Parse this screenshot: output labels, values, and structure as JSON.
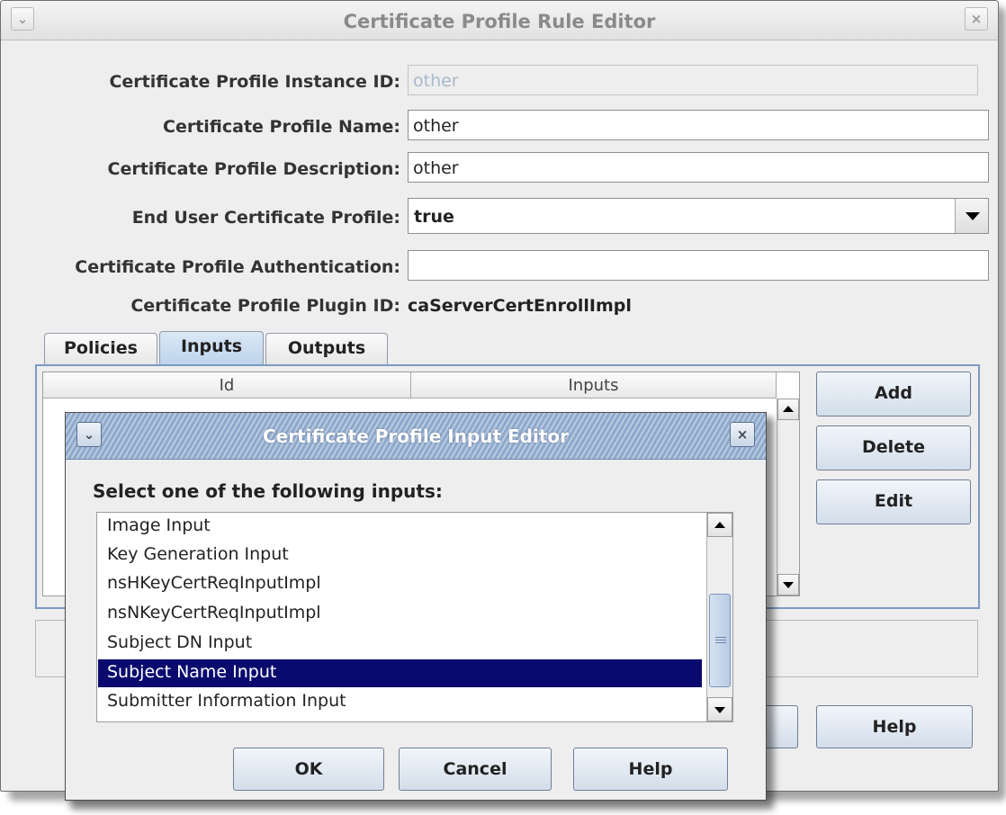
{
  "main_window": {
    "title": "Certificate Profile Rule Editor",
    "menu_icon": "chevron-down-icon",
    "close_icon": "close-icon"
  },
  "form": {
    "instance_id_label": "Certificate Profile Instance ID:",
    "instance_id_value": "other",
    "name_label": "Certificate Profile Name:",
    "name_value": "other",
    "description_label": "Certificate Profile Description:",
    "description_value": "other",
    "end_user_label": "End User Certificate Profile:",
    "end_user_value": "true",
    "authentication_label": "Certificate Profile Authentication:",
    "authentication_value": "",
    "plugin_id_label": "Certificate Profile Plugin ID:",
    "plugin_id_value": "caServerCertEnrollImpl"
  },
  "tabs": [
    {
      "label": "Policies",
      "active": false
    },
    {
      "label": "Inputs",
      "active": true
    },
    {
      "label": "Outputs",
      "active": false
    }
  ],
  "inputs_table": {
    "columns": [
      "Id",
      "Inputs"
    ],
    "rows": []
  },
  "side_buttons": {
    "add": "Add",
    "delete": "Delete",
    "edit": "Edit"
  },
  "bottom_buttons": {
    "help": "Help"
  },
  "dialog": {
    "title": "Certificate Profile Input Editor",
    "prompt": "Select one of the following inputs:",
    "items": [
      "Image Input",
      "Key Generation Input",
      "nsHKeyCertReqInputImpl",
      "nsNKeyCertReqInputImpl",
      "Subject DN Input",
      "Subject Name Input",
      "Submitter Information Input"
    ],
    "selected_item": "Subject Name Input",
    "buttons": {
      "ok": "OK",
      "cancel": "Cancel",
      "help": "Help"
    }
  },
  "colors": {
    "selection": "#0a0a6e",
    "tab_active": "#bdd3ea",
    "button_border": "#6d7f96"
  }
}
